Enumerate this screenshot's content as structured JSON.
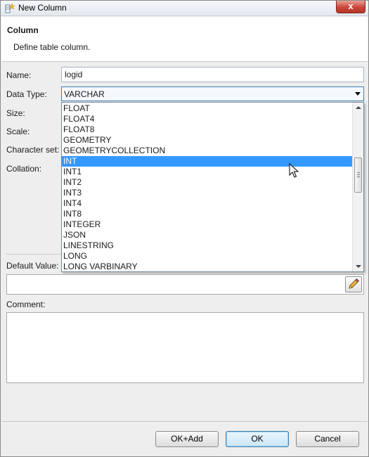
{
  "window": {
    "title": "New Column",
    "close_glyph": "x"
  },
  "header": {
    "title": "Column",
    "description": "Define table column."
  },
  "form": {
    "name_label": "Name:",
    "name_value": "logid",
    "data_type_label": "Data Type:",
    "data_type_value": "VARCHAR",
    "size_label": "Size:",
    "scale_label": "Scale:",
    "charset_label": "Character set:",
    "collation_label": "Collation:",
    "default_label": "Default Value:",
    "default_value": "",
    "comment_label": "Comment:",
    "comment_value": ""
  },
  "dropdown": {
    "options": [
      "FLOAT",
      "FLOAT4",
      "FLOAT8",
      "GEOMETRY",
      "GEOMETRYCOLLECTION",
      "INT",
      "INT1",
      "INT2",
      "INT3",
      "INT4",
      "INT8",
      "INTEGER",
      "JSON",
      "LINESTRING",
      "LONG",
      "LONG VARBINARY"
    ],
    "highlighted": "INT"
  },
  "buttons": {
    "ok_add": "OK+Add",
    "ok": "OK",
    "cancel": "Cancel"
  },
  "icons": [
    "new-column-icon",
    "close-icon",
    "dropdown-arrow-icon",
    "pencil-icon",
    "mouse-cursor-icon"
  ],
  "colors": {
    "selection": "#3399ff",
    "close_button": "#c9463a",
    "focus_border": "#3c7fb1"
  }
}
